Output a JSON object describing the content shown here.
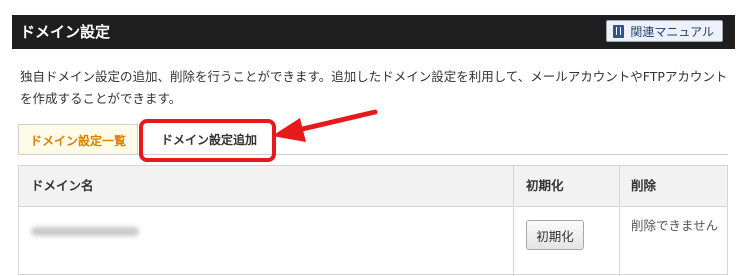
{
  "header": {
    "title": "ドメイン設定",
    "manual_label": "関連マニュアル",
    "manual_icon": "book-icon"
  },
  "description": "独自ドメイン設定の追加、削除を行うことができます。追加したドメイン設定を利用して、メールアカウントやFTPアカウントを作成することができます。",
  "tabs": [
    {
      "label": "ドメイン設定一覧",
      "active": true
    },
    {
      "label": "ドメイン設定追加",
      "active": false
    }
  ],
  "table": {
    "columns": [
      "ドメイン名",
      "初期化",
      "削除"
    ],
    "rows": [
      {
        "domain": "",
        "reset_button": "初期化",
        "delete_status": "削除できません"
      }
    ]
  },
  "colors": {
    "header_bg": "#1e1e1e",
    "active_tab_text": "#e07f00",
    "highlight": "#e8191d"
  }
}
